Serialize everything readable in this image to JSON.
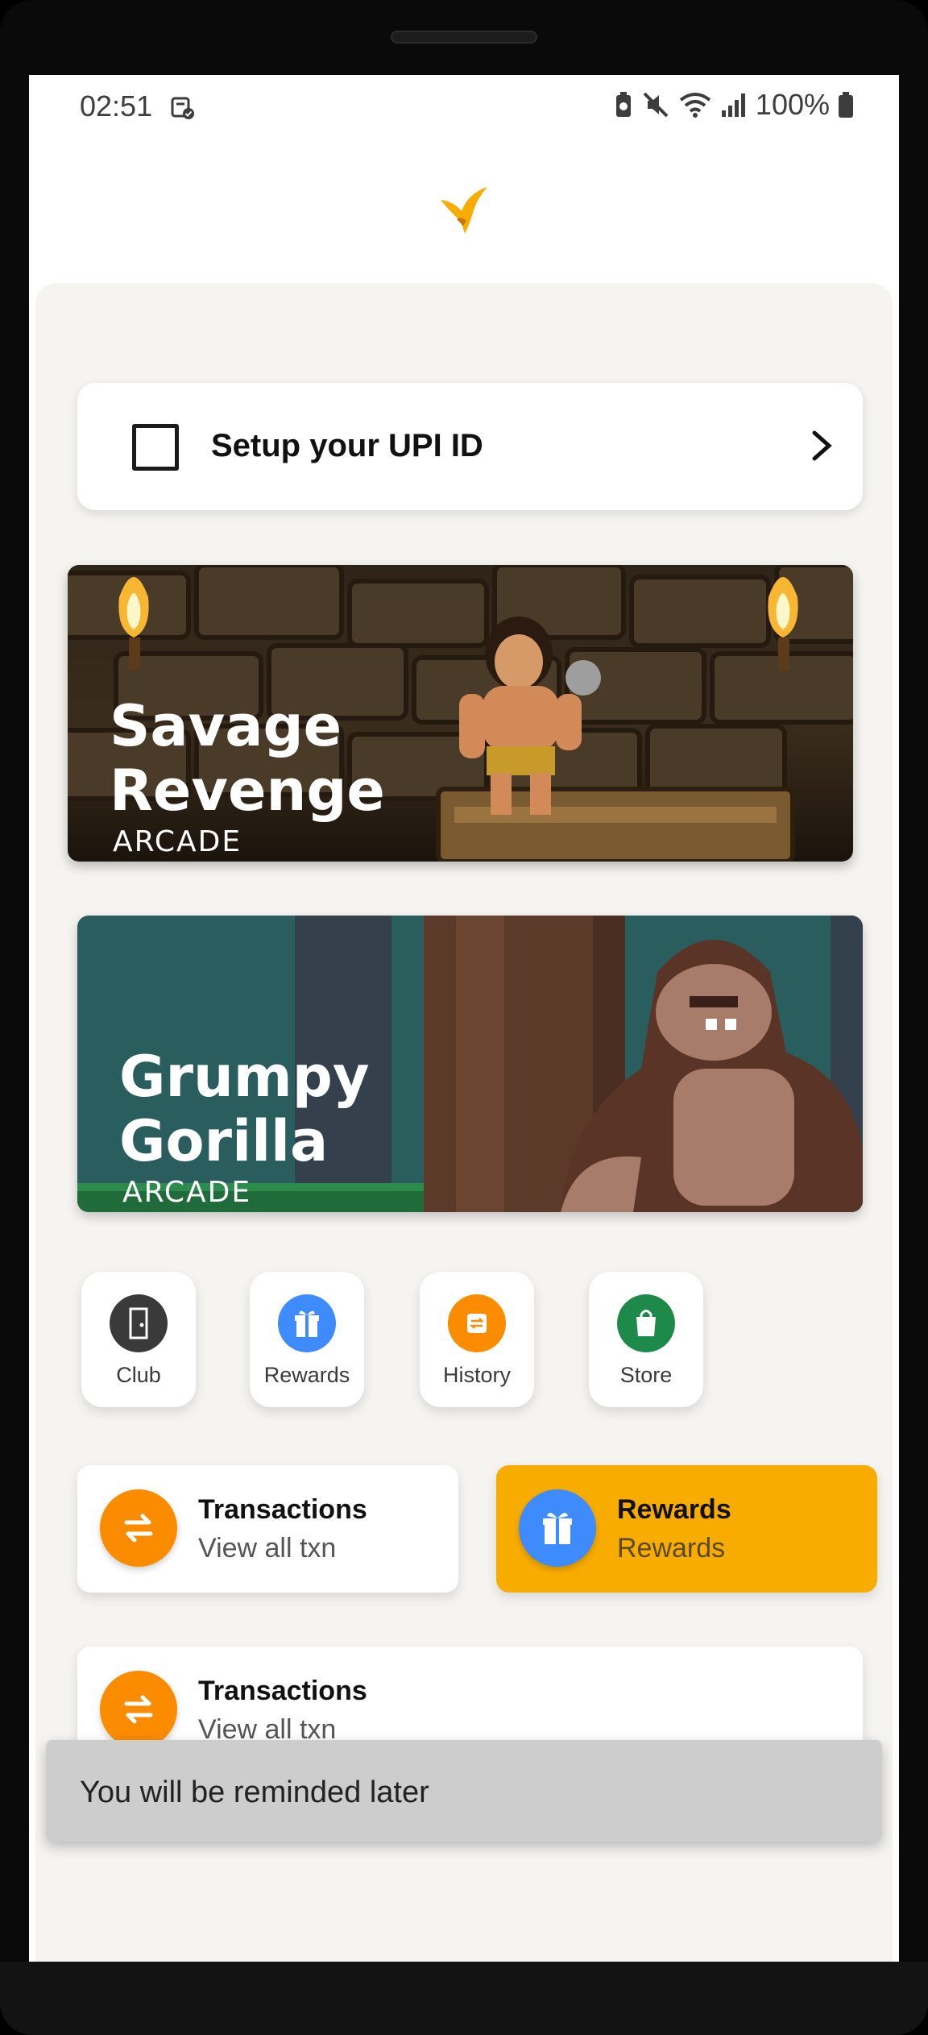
{
  "status_bar": {
    "time": "02:51",
    "battery": "100%"
  },
  "setup": {
    "label": "Setup your UPI ID"
  },
  "banners": [
    {
      "title_line1": "Savage",
      "title_line2": "Revenge",
      "genre": "ARCADE"
    },
    {
      "title_line1": "Grumpy",
      "title_line2": "Gorilla",
      "genre": "ARCADE"
    }
  ],
  "quick_actions": [
    {
      "label": "Club",
      "icon": "door-icon",
      "color": "#3a3a3a"
    },
    {
      "label": "Rewards",
      "icon": "gift-icon",
      "color": "#3d8bfd"
    },
    {
      "label": "History",
      "icon": "history-icon",
      "color": "#fb8c00"
    },
    {
      "label": "Store",
      "icon": "shopping-bag-icon",
      "color": "#1e8a4a"
    }
  ],
  "cards": [
    {
      "title": "Transactions",
      "subtitle": "View all txn",
      "icon": "transfer-arrows-icon",
      "icon_color": "#fb8c00",
      "bg": "#ffffff"
    },
    {
      "title": "Rewards",
      "subtitle": "Rewards",
      "icon": "gift-icon",
      "icon_color": "#3d8bfd",
      "bg": "#f9ac00"
    },
    {
      "title": "Transactions",
      "subtitle": "View all txn",
      "icon": "transfer-arrows-icon",
      "icon_color": "#fb8c00",
      "bg": "#ffffff"
    }
  ],
  "snackbar": {
    "message": "You will be reminded later"
  },
  "colors": {
    "accent": "#f9ac00",
    "panel_bg": "#f5f4f1"
  }
}
